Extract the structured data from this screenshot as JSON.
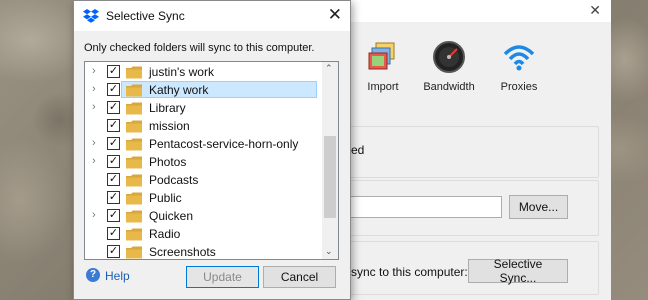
{
  "dialog": {
    "title": "Selective Sync",
    "instruction": "Only checked folders will sync to this computer.",
    "folders": [
      {
        "name": "justin's work",
        "expandable": true,
        "checked": true,
        "selected": false
      },
      {
        "name": "Kathy work",
        "expandable": true,
        "checked": true,
        "selected": true
      },
      {
        "name": "Library",
        "expandable": true,
        "checked": true,
        "selected": false
      },
      {
        "name": "mission",
        "expandable": false,
        "checked": true,
        "selected": false
      },
      {
        "name": "Pentacost-service-horn-only",
        "expandable": true,
        "checked": true,
        "selected": false
      },
      {
        "name": "Photos",
        "expandable": true,
        "checked": true,
        "selected": false
      },
      {
        "name": "Podcasts",
        "expandable": false,
        "checked": true,
        "selected": false
      },
      {
        "name": "Public",
        "expandable": false,
        "checked": true,
        "selected": false
      },
      {
        "name": "Quicken",
        "expandable": true,
        "checked": true,
        "selected": false
      },
      {
        "name": "Radio",
        "expandable": false,
        "checked": true,
        "selected": false
      },
      {
        "name": "Screenshots",
        "expandable": false,
        "checked": true,
        "selected": false
      }
    ],
    "help_label": "Help",
    "update_label": "Update",
    "cancel_label": "Cancel"
  },
  "prefs": {
    "tabs": [
      {
        "label": "Import",
        "icon": "import-icon"
      },
      {
        "label": "Bandwidth",
        "icon": "bandwidth-icon"
      },
      {
        "label": "Proxies",
        "icon": "proxies-icon"
      }
    ],
    "status_text": "ed",
    "move_label": "Move...",
    "sync_label": "sync to this computer:",
    "selective_sync_label": "Selective Sync..."
  },
  "colors": {
    "selection_bg": "#cce8ff",
    "folder": "#e8b84a",
    "help_link": "#1a5fb4",
    "proxies_blue": "#1e88e5"
  }
}
